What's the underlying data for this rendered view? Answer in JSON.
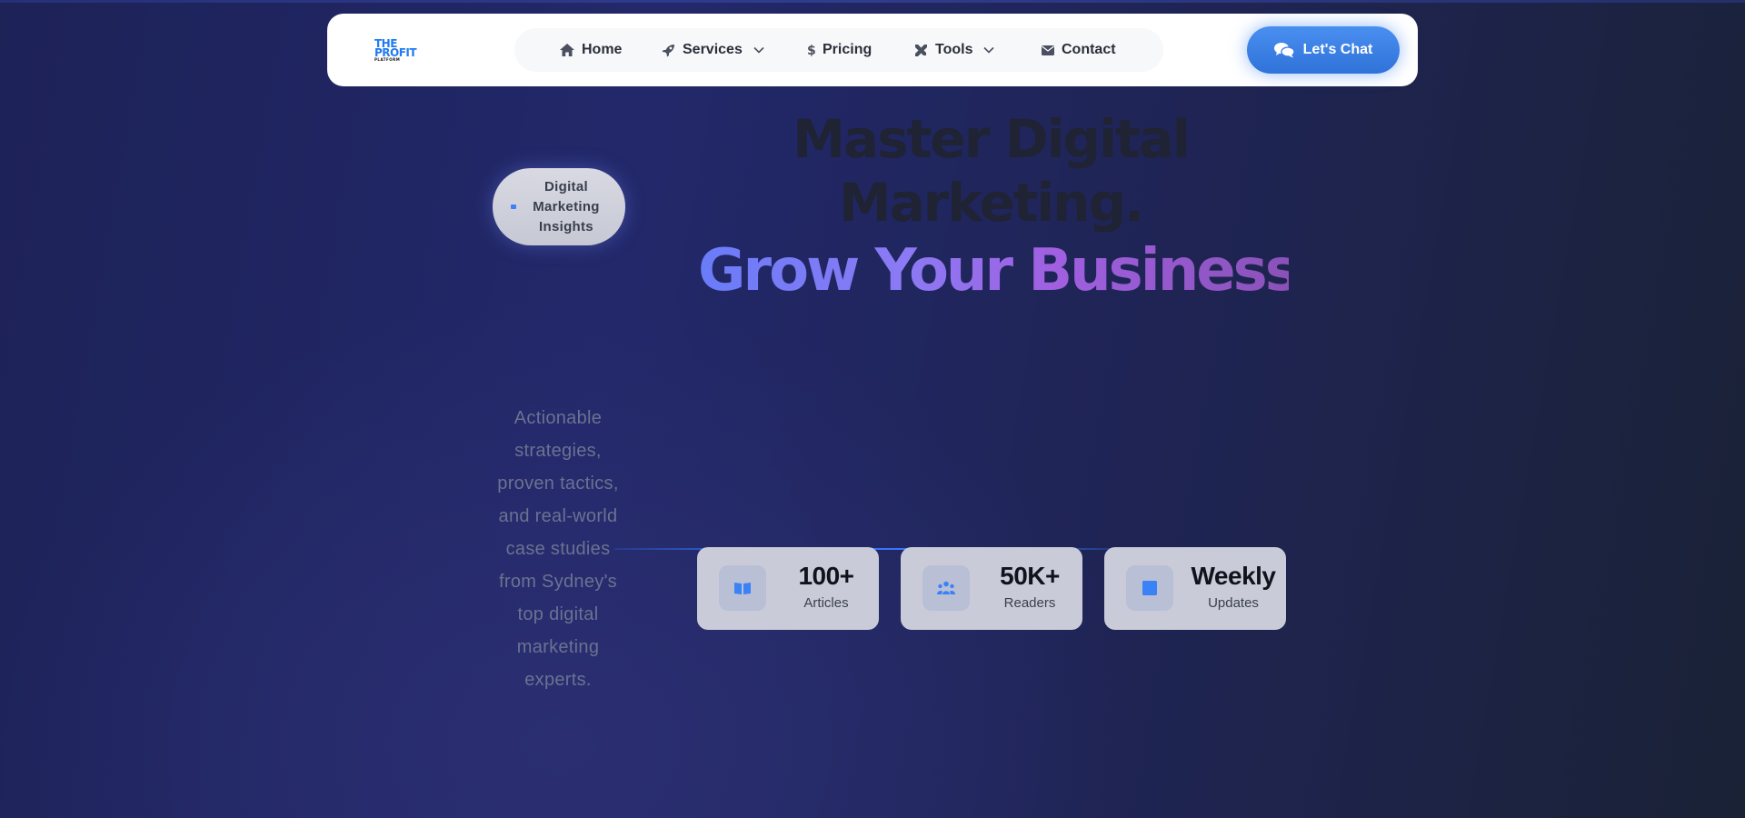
{
  "logo": {
    "line1": "THE",
    "line2": "PROFIT",
    "line3": "PLATFORM"
  },
  "nav": {
    "items": [
      {
        "label": "Home",
        "icon": "home-icon"
      },
      {
        "label": "Services",
        "icon": "rocket-icon",
        "has_dropdown": true
      },
      {
        "label": "Pricing",
        "icon": "dollar-icon"
      },
      {
        "label": "Tools",
        "icon": "tools-icon",
        "has_dropdown": true
      },
      {
        "label": "Contact",
        "icon": "envelope-icon"
      }
    ],
    "cta_label": "Let's Chat",
    "cta_icon": "chat-bubbles-icon"
  },
  "hero": {
    "badge": "Digital Marketing Insights",
    "headline_line1": "Master Digital",
    "headline_line2": "Marketing.",
    "headline_highlight": "Grow Your Business.",
    "subtext": "Actionable strategies, proven tactics, and real-world case studies from Sydney's top digital marketing experts."
  },
  "stats": [
    {
      "value": "100+",
      "label": "Articles",
      "icon": "book-icon"
    },
    {
      "value": "50K+",
      "label": "Readers",
      "icon": "users-icon"
    },
    {
      "value": "Weekly",
      "label": "Updates",
      "icon": "calendar-icon"
    }
  ],
  "colors": {
    "accent": "#3b82f6",
    "gradient_start": "#6a7cf8",
    "gradient_end": "#8a52b8",
    "background": "#1f2454"
  }
}
